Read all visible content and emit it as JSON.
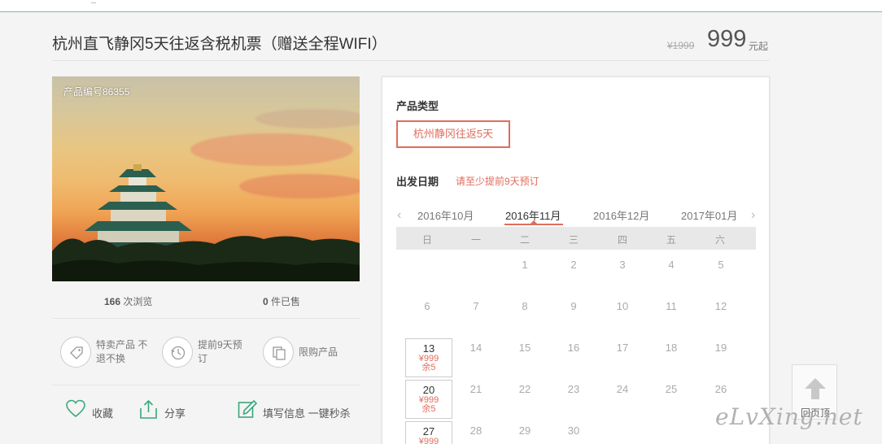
{
  "header": {
    "title": "杭州直飞静冈5天往返含税机票（赠送全程WIFI）",
    "original_price": "¥1999",
    "price": "999",
    "price_unit": "元起"
  },
  "product": {
    "product_no": "产品编号86355",
    "views_count": "166",
    "views_label": "次浏览",
    "sold_count": "0",
    "sold_label": "件已售"
  },
  "features": [
    {
      "icon": "tag-icon",
      "text": "特卖产品 不退不换"
    },
    {
      "icon": "clock-icon",
      "text": "提前9天预订"
    },
    {
      "icon": "copy-icon",
      "text": "限购产品"
    }
  ],
  "actions": {
    "favorite": "收藏",
    "share": "分享",
    "fill_info": "填写信息 一键秒杀"
  },
  "booking": {
    "product_type_label": "产品类型",
    "product_type_option": "杭州静冈往返5天",
    "departure_label": "出发日期",
    "departure_hint": "请至少提前9天预订",
    "months": [
      "2016年10月",
      "2016年11月",
      "2016年12月",
      "2017年01月"
    ],
    "weekdays": [
      "日",
      "一",
      "二",
      "三",
      "四",
      "五",
      "六"
    ],
    "days_row1": [
      "1",
      "2",
      "3",
      "4",
      "5"
    ],
    "days_row2": [
      "6",
      "7",
      "8",
      "9",
      "10",
      "11",
      "12"
    ],
    "days_row3": [
      "14",
      "15",
      "16",
      "17",
      "18",
      "19"
    ],
    "days_row4": [
      "21",
      "22",
      "23",
      "24",
      "25",
      "26"
    ],
    "days_row5": [
      "28",
      "29",
      "30"
    ],
    "available": [
      {
        "day": "13",
        "price": "¥999",
        "remain": "余5"
      },
      {
        "day": "20",
        "price": "¥999",
        "remain": "余5"
      },
      {
        "day": "27",
        "price": "¥999"
      }
    ]
  },
  "back_to_top": "回页顶",
  "watermark": "eLvXing.net",
  "colors": {
    "accent": "#e06d5d",
    "top_line": "#7fb9a8",
    "icon_green": "#3aa77b"
  }
}
